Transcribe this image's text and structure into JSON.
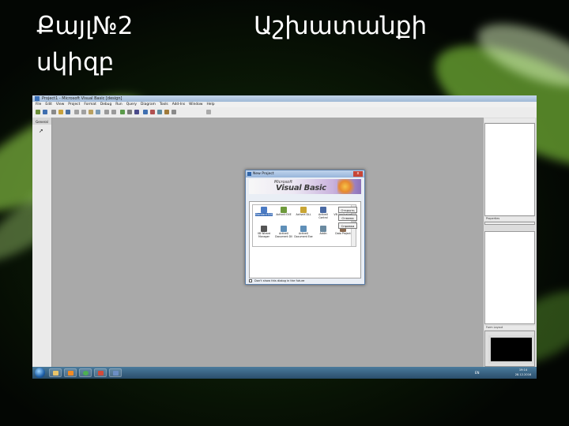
{
  "slide": {
    "title_part1": "Քայլ№2",
    "title_part2": "Աշխատանքի",
    "title_line2": "սկիզբ"
  },
  "vb_window": {
    "title": "Project1 - Microsoft Visual Basic [design]",
    "menu": [
      "File",
      "Edit",
      "View",
      "Project",
      "Format",
      "Debug",
      "Run",
      "Query",
      "Diagram",
      "Tools",
      "Add-Ins",
      "Window",
      "Help"
    ],
    "toolbox_header": "General",
    "pointer_icon": "pointer-arrow-icon",
    "properties_header": "Properties",
    "properties_tabs": [
      "Alphabetic",
      "Categorized"
    ],
    "form_layout_header": "Form Layout"
  },
  "dialog": {
    "title": "New Project",
    "close": "x",
    "banner_line1": "Microsoft",
    "banner_line2": "Visual Basic",
    "tabs": [
      "New",
      "Existing",
      "Recent"
    ],
    "projects": [
      {
        "label": "Standard EXE",
        "color": "#4b7bc4",
        "selected": true
      },
      {
        "label": "ActiveX EXE",
        "color": "#6e9a3c"
      },
      {
        "label": "ActiveX DLL",
        "color": "#c9a534"
      },
      {
        "label": "ActiveX Control",
        "color": "#4a6aa4"
      },
      {
        "label": "VB Application Wizard",
        "color": "#7a7a7a"
      },
      {
        "label": "VB Wizard Manager",
        "color": "#555555"
      },
      {
        "label": "ActiveX Document Dll",
        "color": "#5f8fb8"
      },
      {
        "label": "ActiveX Document Exe",
        "color": "#5f8fb8"
      },
      {
        "label": "Addin",
        "color": "#6a8aa0"
      },
      {
        "label": "Data Project",
        "color": "#8a6a50"
      }
    ],
    "buttons": [
      "Открыть",
      "Отмена",
      "Справка"
    ],
    "checkbox_label": "Don't show this dialog in the future"
  },
  "taskbar": {
    "language": "EN",
    "time": "19:14",
    "date": "28.12.2016"
  },
  "colors": {
    "accent": "#3569b5",
    "background_green": "#1d3a0f"
  }
}
